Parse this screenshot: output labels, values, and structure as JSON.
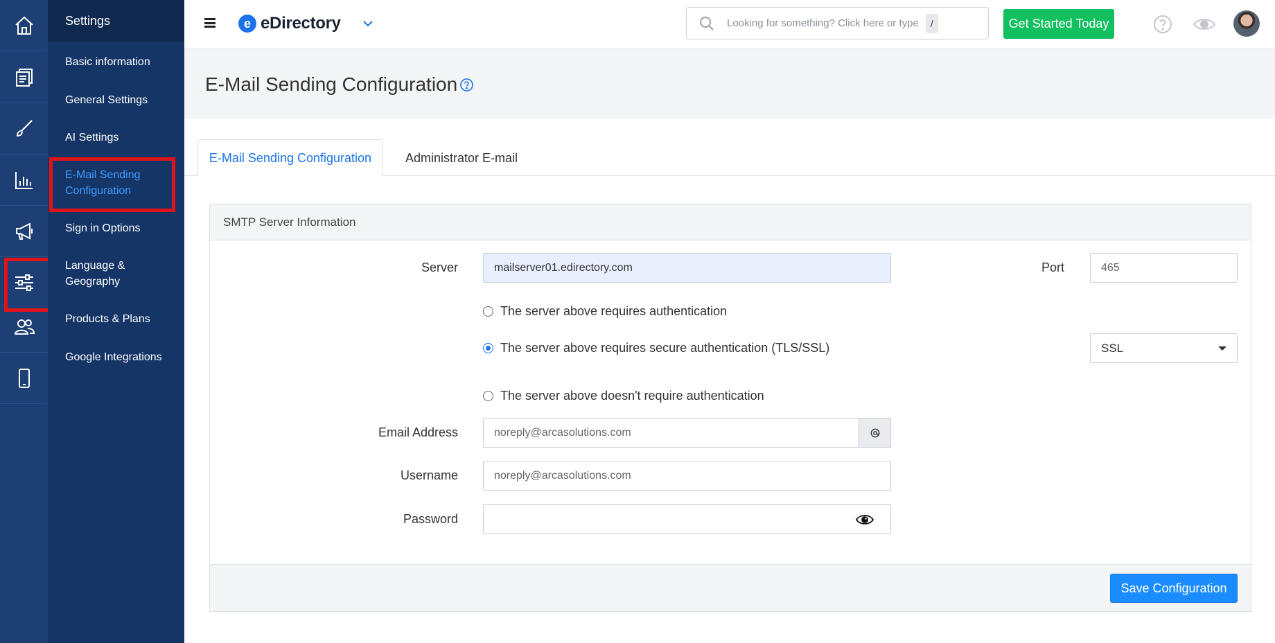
{
  "sidebar": {
    "title": "Settings",
    "items": [
      {
        "label": "Basic information",
        "active": false
      },
      {
        "label": "General Settings",
        "active": false
      },
      {
        "label": "AI Settings",
        "active": false
      },
      {
        "label": "E-Mail Sending Configuration",
        "active": true
      },
      {
        "label": "Sign in Options",
        "active": false
      },
      {
        "label": "Language & Geography",
        "active": false
      },
      {
        "label": "Products & Plans",
        "active": false
      },
      {
        "label": "Google Integrations",
        "active": false
      }
    ]
  },
  "rail": {
    "icons": [
      "home-icon",
      "documents-icon",
      "brush-icon",
      "bar-chart-icon",
      "megaphone-icon",
      "sliders-icon",
      "users-icon",
      "mobile-icon"
    ],
    "highlighted": "sliders-icon"
  },
  "header": {
    "brand_logo_letter": "e",
    "brand_name": "eDirectory",
    "search_placeholder": "Looking for something? Click here or type",
    "search_shortcut": "/",
    "cta_label": "Get Started Today"
  },
  "page": {
    "title": "E-Mail Sending Configuration"
  },
  "tabs": [
    {
      "label": "E-Mail Sending Configuration",
      "active": true
    },
    {
      "label": "Administrator E-mail",
      "active": false
    }
  ],
  "smtp": {
    "panel_title": "SMTP Server Information",
    "server_label": "Server",
    "server_value": "mailserver01.edirectory.com",
    "port_label": "Port",
    "port_value": "465",
    "auth_options": [
      {
        "label": "The server above requires authentication",
        "checked": false
      },
      {
        "label": "The server above requires secure authentication (TLS/SSL)",
        "checked": true
      },
      {
        "label": "The server above doesn't require authentication",
        "checked": false
      }
    ],
    "security_type": "SSL",
    "email_label": "Email Address",
    "email_value": "noreply@arcasolutions.com",
    "username_label": "Username",
    "username_value": "noreply@arcasolutions.com",
    "password_label": "Password",
    "password_value": "",
    "save_label": "Save Configuration"
  },
  "colors": {
    "rail_bg": "#1d3f74",
    "sidebar_bg": "#153566",
    "accent": "#1a73e8",
    "cta_green": "#12c05f",
    "highlight_red": "#e0131b"
  }
}
